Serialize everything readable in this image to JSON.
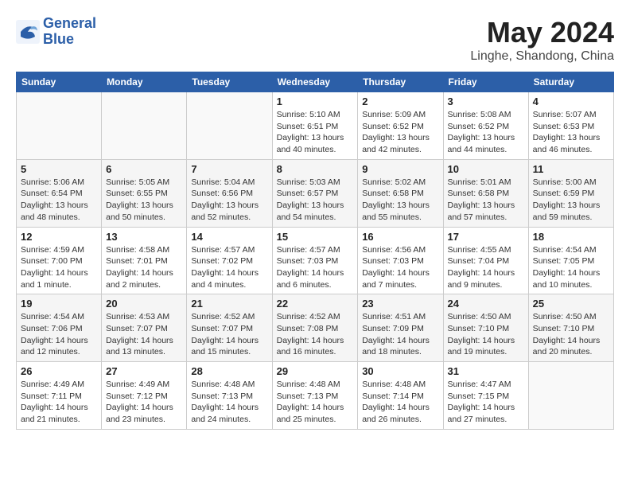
{
  "header": {
    "logo_line1": "General",
    "logo_line2": "Blue",
    "month": "May 2024",
    "location": "Linghe, Shandong, China"
  },
  "weekdays": [
    "Sunday",
    "Monday",
    "Tuesday",
    "Wednesday",
    "Thursday",
    "Friday",
    "Saturday"
  ],
  "weeks": [
    [
      {
        "day": "",
        "info": ""
      },
      {
        "day": "",
        "info": ""
      },
      {
        "day": "",
        "info": ""
      },
      {
        "day": "1",
        "info": "Sunrise: 5:10 AM\nSunset: 6:51 PM\nDaylight: 13 hours\nand 40 minutes."
      },
      {
        "day": "2",
        "info": "Sunrise: 5:09 AM\nSunset: 6:52 PM\nDaylight: 13 hours\nand 42 minutes."
      },
      {
        "day": "3",
        "info": "Sunrise: 5:08 AM\nSunset: 6:52 PM\nDaylight: 13 hours\nand 44 minutes."
      },
      {
        "day": "4",
        "info": "Sunrise: 5:07 AM\nSunset: 6:53 PM\nDaylight: 13 hours\nand 46 minutes."
      }
    ],
    [
      {
        "day": "5",
        "info": "Sunrise: 5:06 AM\nSunset: 6:54 PM\nDaylight: 13 hours\nand 48 minutes."
      },
      {
        "day": "6",
        "info": "Sunrise: 5:05 AM\nSunset: 6:55 PM\nDaylight: 13 hours\nand 50 minutes."
      },
      {
        "day": "7",
        "info": "Sunrise: 5:04 AM\nSunset: 6:56 PM\nDaylight: 13 hours\nand 52 minutes."
      },
      {
        "day": "8",
        "info": "Sunrise: 5:03 AM\nSunset: 6:57 PM\nDaylight: 13 hours\nand 54 minutes."
      },
      {
        "day": "9",
        "info": "Sunrise: 5:02 AM\nSunset: 6:58 PM\nDaylight: 13 hours\nand 55 minutes."
      },
      {
        "day": "10",
        "info": "Sunrise: 5:01 AM\nSunset: 6:58 PM\nDaylight: 13 hours\nand 57 minutes."
      },
      {
        "day": "11",
        "info": "Sunrise: 5:00 AM\nSunset: 6:59 PM\nDaylight: 13 hours\nand 59 minutes."
      }
    ],
    [
      {
        "day": "12",
        "info": "Sunrise: 4:59 AM\nSunset: 7:00 PM\nDaylight: 14 hours\nand 1 minute."
      },
      {
        "day": "13",
        "info": "Sunrise: 4:58 AM\nSunset: 7:01 PM\nDaylight: 14 hours\nand 2 minutes."
      },
      {
        "day": "14",
        "info": "Sunrise: 4:57 AM\nSunset: 7:02 PM\nDaylight: 14 hours\nand 4 minutes."
      },
      {
        "day": "15",
        "info": "Sunrise: 4:57 AM\nSunset: 7:03 PM\nDaylight: 14 hours\nand 6 minutes."
      },
      {
        "day": "16",
        "info": "Sunrise: 4:56 AM\nSunset: 7:03 PM\nDaylight: 14 hours\nand 7 minutes."
      },
      {
        "day": "17",
        "info": "Sunrise: 4:55 AM\nSunset: 7:04 PM\nDaylight: 14 hours\nand 9 minutes."
      },
      {
        "day": "18",
        "info": "Sunrise: 4:54 AM\nSunset: 7:05 PM\nDaylight: 14 hours\nand 10 minutes."
      }
    ],
    [
      {
        "day": "19",
        "info": "Sunrise: 4:54 AM\nSunset: 7:06 PM\nDaylight: 14 hours\nand 12 minutes."
      },
      {
        "day": "20",
        "info": "Sunrise: 4:53 AM\nSunset: 7:07 PM\nDaylight: 14 hours\nand 13 minutes."
      },
      {
        "day": "21",
        "info": "Sunrise: 4:52 AM\nSunset: 7:07 PM\nDaylight: 14 hours\nand 15 minutes."
      },
      {
        "day": "22",
        "info": "Sunrise: 4:52 AM\nSunset: 7:08 PM\nDaylight: 14 hours\nand 16 minutes."
      },
      {
        "day": "23",
        "info": "Sunrise: 4:51 AM\nSunset: 7:09 PM\nDaylight: 14 hours\nand 18 minutes."
      },
      {
        "day": "24",
        "info": "Sunrise: 4:50 AM\nSunset: 7:10 PM\nDaylight: 14 hours\nand 19 minutes."
      },
      {
        "day": "25",
        "info": "Sunrise: 4:50 AM\nSunset: 7:10 PM\nDaylight: 14 hours\nand 20 minutes."
      }
    ],
    [
      {
        "day": "26",
        "info": "Sunrise: 4:49 AM\nSunset: 7:11 PM\nDaylight: 14 hours\nand 21 minutes."
      },
      {
        "day": "27",
        "info": "Sunrise: 4:49 AM\nSunset: 7:12 PM\nDaylight: 14 hours\nand 23 minutes."
      },
      {
        "day": "28",
        "info": "Sunrise: 4:48 AM\nSunset: 7:13 PM\nDaylight: 14 hours\nand 24 minutes."
      },
      {
        "day": "29",
        "info": "Sunrise: 4:48 AM\nSunset: 7:13 PM\nDaylight: 14 hours\nand 25 minutes."
      },
      {
        "day": "30",
        "info": "Sunrise: 4:48 AM\nSunset: 7:14 PM\nDaylight: 14 hours\nand 26 minutes."
      },
      {
        "day": "31",
        "info": "Sunrise: 4:47 AM\nSunset: 7:15 PM\nDaylight: 14 hours\nand 27 minutes."
      },
      {
        "day": "",
        "info": ""
      }
    ]
  ]
}
